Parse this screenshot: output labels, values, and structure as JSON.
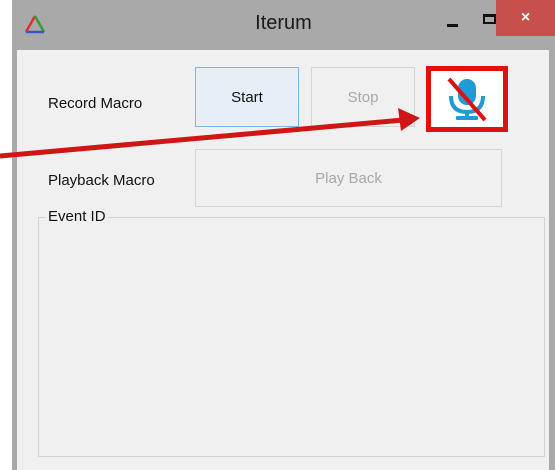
{
  "window": {
    "title": "Iterum",
    "close_glyph": "×",
    "icon": "triangle-logo-icon",
    "colors": {
      "frame": "#a9a9a9",
      "client": "#f0f0f0",
      "close": "#c7504c",
      "highlight": "#e01010"
    }
  },
  "record": {
    "label": "Record Macro",
    "start_label": "Start",
    "stop_label": "Stop",
    "mic_icon": "microphone-muted-icon"
  },
  "playback": {
    "label": "Playback Macro",
    "button_label": "Play Back"
  },
  "events": {
    "group_title": "Event ID"
  }
}
